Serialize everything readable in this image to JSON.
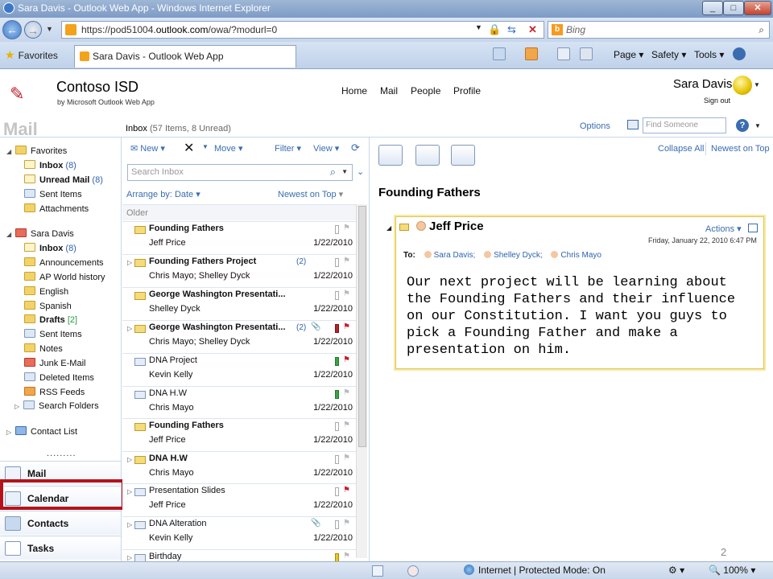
{
  "browser": {
    "title": "Sara Davis - Outlook Web App - Windows Internet Explorer",
    "url_prefix": "https://pod51004.",
    "url_host": "outlook.com",
    "url_suffix": "/owa/?modurl=0",
    "search_placeholder": "Bing",
    "favorites_label": "Favorites",
    "tab_label": "Sara Davis - Outlook Web App",
    "menus": [
      "Page",
      "Safety",
      "Tools"
    ],
    "status_zone": "Internet | Protected Mode: On",
    "zoom": "100%"
  },
  "header": {
    "org": "Contoso ISD",
    "org_sub": "by Microsoft Outlook Web App",
    "nav": [
      "Home",
      "Mail",
      "People",
      "Profile"
    ],
    "user": "Sara Davis",
    "signout": "Sign out"
  },
  "toolbar": {
    "module_title": "Mail",
    "folder": "Inbox",
    "folder_counts": "(57 Items, 8 Unread)",
    "options": "Options",
    "find_placeholder": "Find Someone"
  },
  "sidebar": {
    "favorites": "Favorites",
    "fav_items": [
      {
        "label": "Inbox",
        "count": "(8)"
      },
      {
        "label": "Unread Mail",
        "count": "(8)"
      },
      {
        "label": "Sent Items"
      },
      {
        "label": "Attachments"
      }
    ],
    "mailbox": "Sara Davis",
    "folders": [
      {
        "label": "Inbox",
        "count": "(8)"
      },
      {
        "label": "Announcements"
      },
      {
        "label": "AP World history"
      },
      {
        "label": "English"
      },
      {
        "label": "Spanish"
      },
      {
        "label": "Drafts",
        "count": "[2]"
      },
      {
        "label": "Sent Items"
      },
      {
        "label": "Notes"
      },
      {
        "label": "Junk E-Mail"
      },
      {
        "label": "Deleted Items"
      },
      {
        "label": "RSS Feeds"
      },
      {
        "label": "Search Folders"
      }
    ],
    "contact_list": "Contact List",
    "bottom": [
      "Mail",
      "Calendar",
      "Contacts",
      "Tasks"
    ]
  },
  "list": {
    "new": "New",
    "move": "Move",
    "filter": "Filter",
    "view": "View",
    "search_placeholder": "Search Inbox",
    "arrange_label": "Arrange by:",
    "arrange_value": "Date",
    "sort": "Newest on Top",
    "group": "Older",
    "messages": [
      {
        "subject": "Founding Fathers",
        "from": "Jeff Price",
        "date": "1/22/2010"
      },
      {
        "subject": "Founding Fathers Project",
        "from": "Chris Mayo; Shelley Dyck",
        "date": "1/22/2010",
        "count": "(2)"
      },
      {
        "subject": "George Washington Presentati...",
        "from": "Shelley Dyck",
        "date": "1/22/2010"
      },
      {
        "subject": "George Washington Presentati...",
        "from": "Chris Mayo; Shelley Dyck",
        "date": "1/22/2010",
        "count": "(2)"
      },
      {
        "subject": "DNA Project",
        "from": "Kevin Kelly",
        "date": "1/22/2010"
      },
      {
        "subject": "DNA H.W",
        "from": "Chris Mayo",
        "date": "1/22/2010"
      },
      {
        "subject": "Founding Fathers",
        "from": "Jeff Price",
        "date": "1/22/2010"
      },
      {
        "subject": "DNA H.W",
        "from": "Chris Mayo",
        "date": "1/22/2010"
      },
      {
        "subject": "Presentation Slides",
        "from": "Jeff Price",
        "date": "1/22/2010"
      },
      {
        "subject": "DNA Alteration",
        "from": "Kevin Kelly",
        "date": "1/22/2010"
      },
      {
        "subject": "Birthday",
        "from": "",
        "date": ""
      }
    ]
  },
  "reading": {
    "collapse": "Collapse All",
    "order": "Newest on Top",
    "title": "Founding Fathers",
    "sender": "Jeff Price",
    "actions": "Actions",
    "date": "Friday, January 22, 2010 6:47 PM",
    "to_label": "To:",
    "recipients": [
      "Sara Davis;",
      "Shelley Dyck;",
      "Chris Mayo"
    ],
    "body": "Our next project will be learning about the Founding Fathers and their influence on our Constitution. I want you guys to pick a Founding Father and make a presentation on him."
  },
  "slide_number": "2"
}
